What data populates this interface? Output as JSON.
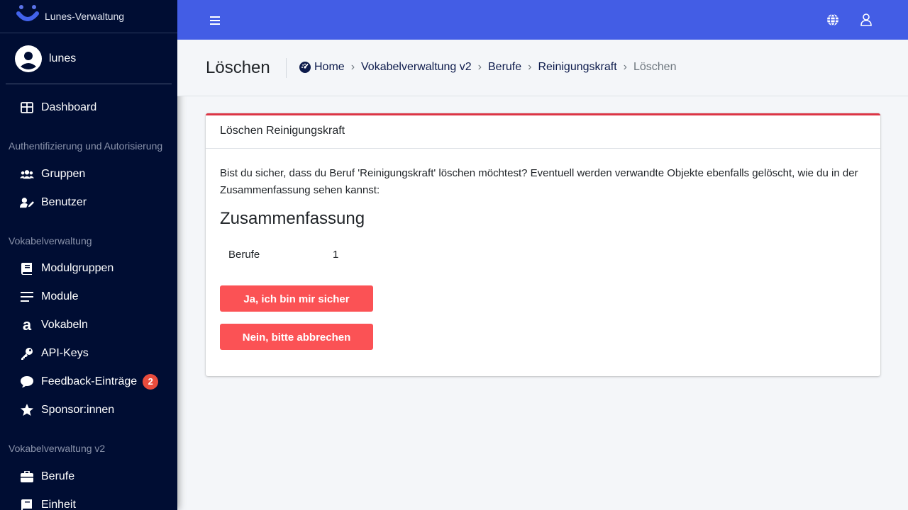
{
  "app": {
    "brand": "Lunes-Verwaltung",
    "user": "lunes"
  },
  "sidebar": {
    "dashboard": "Dashboard",
    "section_auth": "Authentifizierung und Autorisierung",
    "groups": "Gruppen",
    "users": "Benutzer",
    "section_vocab": "Vokabelverwaltung",
    "module_groups": "Modulgruppen",
    "modules": "Module",
    "vocabulary": "Vokabeln",
    "api_keys": "API-Keys",
    "feedback": "Feedback-Einträge",
    "feedback_count": "2",
    "sponsors": "Sponsor:innen",
    "section_vocab_v2": "Vokabelverwaltung v2",
    "professions": "Berufe",
    "unit": "Einheit"
  },
  "header": {
    "title": "Löschen",
    "breadcrumb": {
      "home": "Home",
      "level1": "Vokabelverwaltung v2",
      "level2": "Berufe",
      "level3": "Reinigungskraft",
      "current": "Löschen",
      "separator": "›"
    }
  },
  "card": {
    "title": "Löschen Reinigungskraft",
    "text": "Bist du sicher, dass du Beruf 'Reinigungskraft' löschen möchtest? Eventuell werden verwandte Objekte ebenfalls gelöscht, wie du in der Zusammenfassung sehen kannst:",
    "summary_title": "Zusammenfassung",
    "summary": [
      {
        "label": "Berufe",
        "count": "1"
      }
    ],
    "confirm_label": "Ja, ich bin mir sicher",
    "cancel_label": "Nein, bitte abbrechen"
  },
  "colors": {
    "sidebar_bg": "#000d33",
    "topbar_bg": "#435de5",
    "danger": "#fb5255",
    "card_accent": "#dc3545"
  },
  "icons": {
    "menu": "hamburger-icon",
    "language": "globe-icon",
    "account": "user-icon"
  }
}
